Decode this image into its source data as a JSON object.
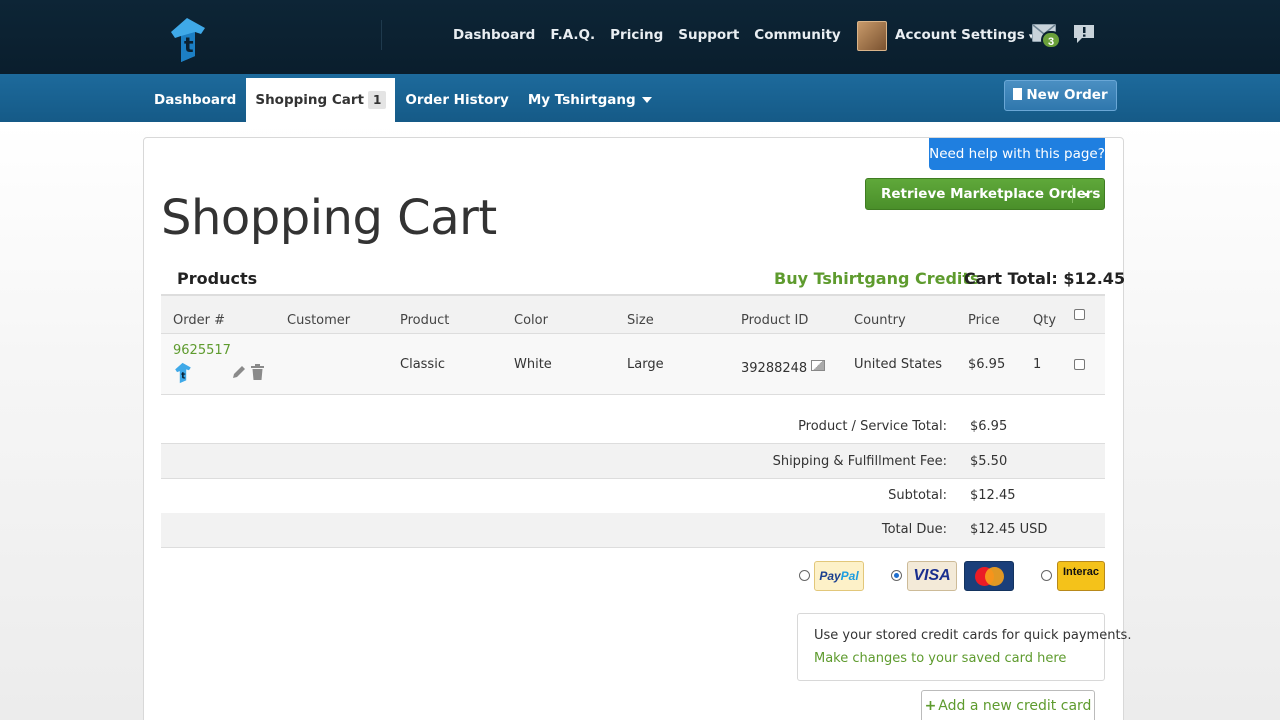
{
  "topnav": {
    "links": [
      "Dashboard",
      "F.A.Q.",
      "Pricing",
      "Support",
      "Community"
    ],
    "account_label": "Account Settings",
    "caret": "▾",
    "mail_count": "3"
  },
  "subnav": {
    "items": [
      "Dashboard",
      "Shopping Cart",
      "Order History",
      "My Tshirtgang"
    ],
    "cart_count": "1",
    "new_order_label": "New Order"
  },
  "page": {
    "help_label": "Need help with this page?",
    "retrieve_label": "Retrieve Marketplace Orders",
    "title": "Shopping Cart",
    "products_label": "Products",
    "buy_credits_label": "Buy Tshirtgang Credits",
    "cart_total_label": "Cart Total: $12.45"
  },
  "table": {
    "headers": [
      "Order #",
      "Customer",
      "Product",
      "Color",
      "Size",
      "Product ID",
      "Country",
      "Price",
      "Qty"
    ],
    "rows": [
      {
        "order": "9625517",
        "customer": "",
        "product": "Classic",
        "color": "White",
        "size": "Large",
        "product_id": "39288248",
        "country": "United States",
        "price": "$6.95",
        "qty": "1"
      }
    ]
  },
  "summary": [
    {
      "label": "Product / Service Total:",
      "value": "$6.95"
    },
    {
      "label": "Shipping & Fulfillment Fee:",
      "value": "$5.50"
    },
    {
      "label": "Subtotal:",
      "value": "$12.45"
    },
    {
      "label": "Total Due:",
      "value": "$12.45 USD"
    }
  ],
  "payment": {
    "paypal_a": "Pay",
    "paypal_b": "Pal",
    "visa": "VISA",
    "interac": "Interac",
    "selected": "card"
  },
  "stored": {
    "text": "Use your stored credit cards for quick payments.",
    "link": "Make changes to your saved card here",
    "add_label": "Add a new credit card",
    "plus": "+"
  },
  "colors": {
    "accent_green": "#5e9b2e",
    "nav_blue": "#1d6a9c",
    "help_blue": "#1f7fe0"
  }
}
